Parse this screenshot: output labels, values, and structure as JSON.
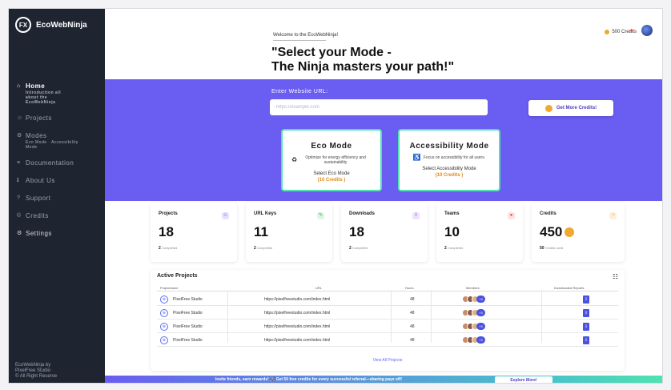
{
  "sidebar": {
    "logo_mark": "FX",
    "app_name": "EcoWebNinja",
    "items": [
      {
        "icon": "⌂",
        "label": "Home",
        "sub": "Introduction all about the EcoWebNinja"
      },
      {
        "icon": "☺",
        "label": "Projects",
        "sub": ""
      },
      {
        "icon": "⚙",
        "label": "Modes",
        "sub": "Eco Mode · Accessibility Mode"
      },
      {
        "icon": "≡",
        "label": "Documentation",
        "sub": ""
      },
      {
        "icon": "ℹ",
        "label": "About Us",
        "sub": ""
      },
      {
        "icon": "?",
        "label": "Support",
        "sub": ""
      },
      {
        "icon": "©",
        "label": "Credits",
        "sub": ""
      },
      {
        "icon": "⚙",
        "label": "Settings",
        "sub": ""
      }
    ],
    "footer_line1": "EcoWebNinja by",
    "footer_line2": "PixelFree Studio",
    "footer_line3": "© All Right Reserve"
  },
  "header": {
    "welcome": "Welcome to the EcoWebNinja!",
    "headline_1": "\"Select your Mode -",
    "headline_2": "The Ninja masters your path!\"",
    "credits": "500 Credits"
  },
  "hero": {
    "url_label": "Enter Website URL:",
    "url_placeholder": "https://example.com",
    "get_credits": "Get More Credits!",
    "eco": {
      "title": "Eco Mode",
      "desc": "Optimize for energy efficiency and sustainability",
      "select": "Select Eco Mode",
      "cost": "(10 Credits )"
    },
    "access": {
      "title": "Accessibility Mode",
      "desc": "Focus on accessibility for all users.",
      "select": "Select Accessibility Mode",
      "cost": "(10 Credits )"
    }
  },
  "stats": [
    {
      "label": "Projects",
      "value": "18",
      "count": "2",
      "sub": "Completed",
      "icon_bg": "#e6e1fb",
      "icon_color": "#6a5df2",
      "icon": "☺"
    },
    {
      "label": "URL Keys",
      "value": "11",
      "count": "2",
      "sub": "Completed",
      "icon_bg": "#dff5e3",
      "icon_color": "#2eaa4a",
      "icon": "✎"
    },
    {
      "label": "Downloads",
      "value": "18",
      "count": "2",
      "sub": "Completed",
      "icon_bg": "#ede1fb",
      "icon_color": "#8a4ee0",
      "icon": "⇩"
    },
    {
      "label": "Teams",
      "value": "10",
      "count": "2",
      "sub": "Completed",
      "icon_bg": "#fde1e1",
      "icon_color": "#e04848",
      "icon": "●"
    },
    {
      "label": "Credits",
      "value": "450",
      "count": "50",
      "sub": "Credits used",
      "icon_bg": "#fdeed6",
      "icon_color": "#e0881a",
      "icon": "◔"
    }
  ],
  "table": {
    "title": "Active Projects",
    "headers": [
      "Projectname",
      "URL",
      "Hours",
      "Members",
      "Downloaded Reports"
    ],
    "rows": [
      {
        "name": "PixelFree Studio",
        "url": "https://pixelfreestudio.com/index.html",
        "hours": "48",
        "more": "+3"
      },
      {
        "name": "PixelFree Studio",
        "url": "https://pixelfreestudio.com/index.html",
        "hours": "48",
        "more": "+3"
      },
      {
        "name": "PixelFree Studio",
        "url": "https://pixelfreestudio.com/index.html",
        "hours": "48",
        "more": "+3"
      },
      {
        "name": "PixelFree Studio",
        "url": "https://pixelfreestudio.com/index.html",
        "hours": "48",
        "more": "+3"
      }
    ],
    "view_all": "View All Projects"
  },
  "footer": {
    "text": "Invite friends, earn rewards! 🚀 Get 50 free credits for every successful referral—sharing pays off!",
    "button": "Explore More!"
  },
  "colors": {
    "sidebar": "#1e2430",
    "hero": "#6a5df2",
    "mode_border": "#4fe3b0",
    "accent": "#4a52e0",
    "coin": "#f0a830"
  }
}
